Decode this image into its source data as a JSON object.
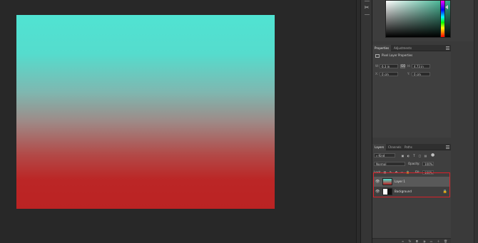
{
  "properties": {
    "tabs": [
      "Properties",
      "Adjustments"
    ],
    "header": "Pixel Layer Properties",
    "w_label": "W:",
    "w_value": "6.3 in",
    "h_label": "H:",
    "h_value": "4.73 in",
    "x_label": "X:",
    "x_value": "0 cm",
    "y_label": "Y:",
    "y_value": "0 cm",
    "link_glyph": "GO"
  },
  "layers": {
    "tabs": [
      "Layers",
      "Channels",
      "Paths"
    ],
    "filter_label": "Kind",
    "blend_mode": "Normal",
    "opacity_label": "Opacity:",
    "opacity_value": "100%",
    "lock_label": "Lock:",
    "fill_label": "Fill:",
    "fill_value": "100%",
    "items": [
      {
        "name": "Layer 1"
      },
      {
        "name": "Background"
      }
    ]
  },
  "colors": {
    "gradient_top": "#50e3d2",
    "gradient_bottom": "#bb2323",
    "highlight": "#d8222a"
  }
}
